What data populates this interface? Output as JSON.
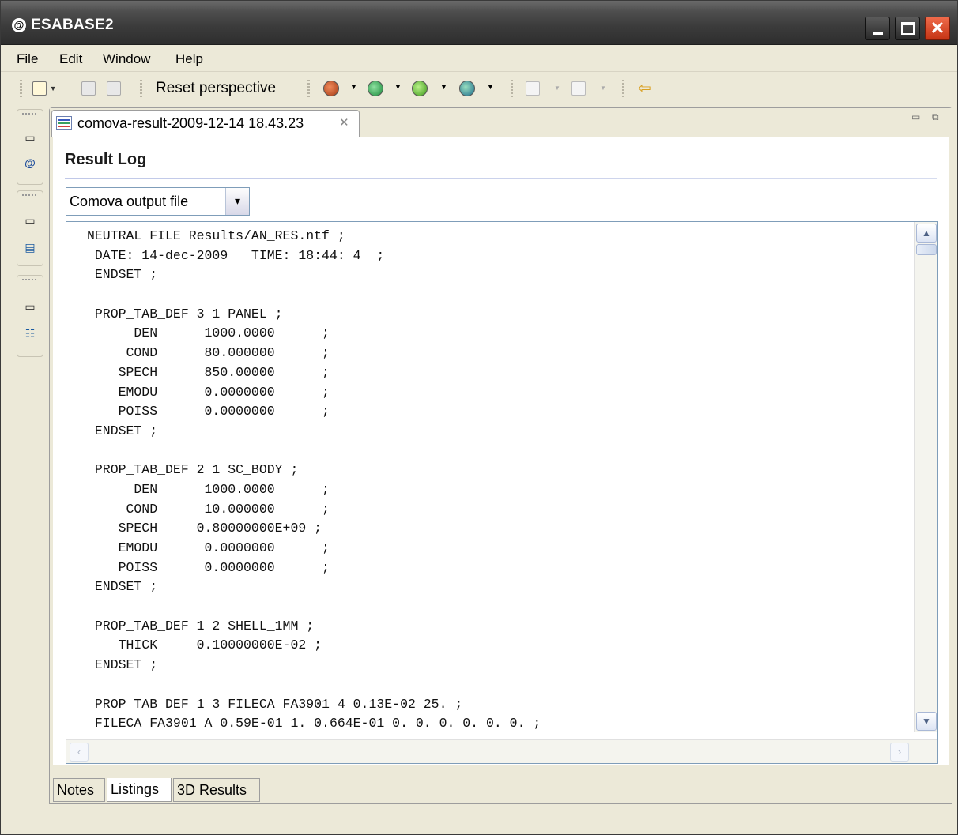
{
  "window": {
    "title": "ESABASE2",
    "app_icon_glyph": "@"
  },
  "menu": [
    {
      "label": "File"
    },
    {
      "label": "Edit"
    },
    {
      "label": "Window"
    },
    {
      "label": "Help"
    }
  ],
  "toolbar": {
    "reset_label": "Reset perspective"
  },
  "editor": {
    "tab_label": "comova-result-2009-12-14 18.43.23",
    "tab_close": "✕",
    "section_title": "Result Log",
    "select": {
      "value": "Comova output file",
      "button_glyph": "▾"
    },
    "log_lines": [
      "NEUTRAL FILE Results/AN_RES.ntf ;",
      " DATE: 14-dec-2009   TIME: 18:44: 4  ;",
      " ENDSET ;",
      "",
      " PROP_TAB_DEF 3 1 PANEL ;",
      "      DEN      1000.0000      ;",
      "     COND      80.000000      ;",
      "    SPECH      850.00000      ;",
      "    EMODU      0.0000000      ;",
      "    POISS      0.0000000      ;",
      " ENDSET ;",
      "",
      " PROP_TAB_DEF 2 1 SC_BODY ;",
      "      DEN      1000.0000      ;",
      "     COND      10.000000      ;",
      "    SPECH     0.80000000E+09 ;",
      "    EMODU      0.0000000      ;",
      "    POISS      0.0000000      ;",
      " ENDSET ;",
      "",
      " PROP_TAB_DEF 1 2 SHELL_1MM ;",
      "    THICK     0.10000000E-02 ;",
      " ENDSET ;",
      "",
      " PROP_TAB_DEF 1 3 FILECA_FA3901 4 0.13E-02 25. ;",
      " FILECA_FA3901_A 0.59E-01 1. 0.664E-01 0. 0. 0. 0. 0. 0. ;"
    ]
  },
  "bottom_tabs": [
    {
      "label": "Notes"
    },
    {
      "label": "Listings"
    },
    {
      "label": "3D Results"
    }
  ],
  "colors": {
    "titlebar": "#3b3b3b",
    "close_button": "#d9431f",
    "chrome": "#ece9d8",
    "selection_rule": "#c0c8e8"
  }
}
